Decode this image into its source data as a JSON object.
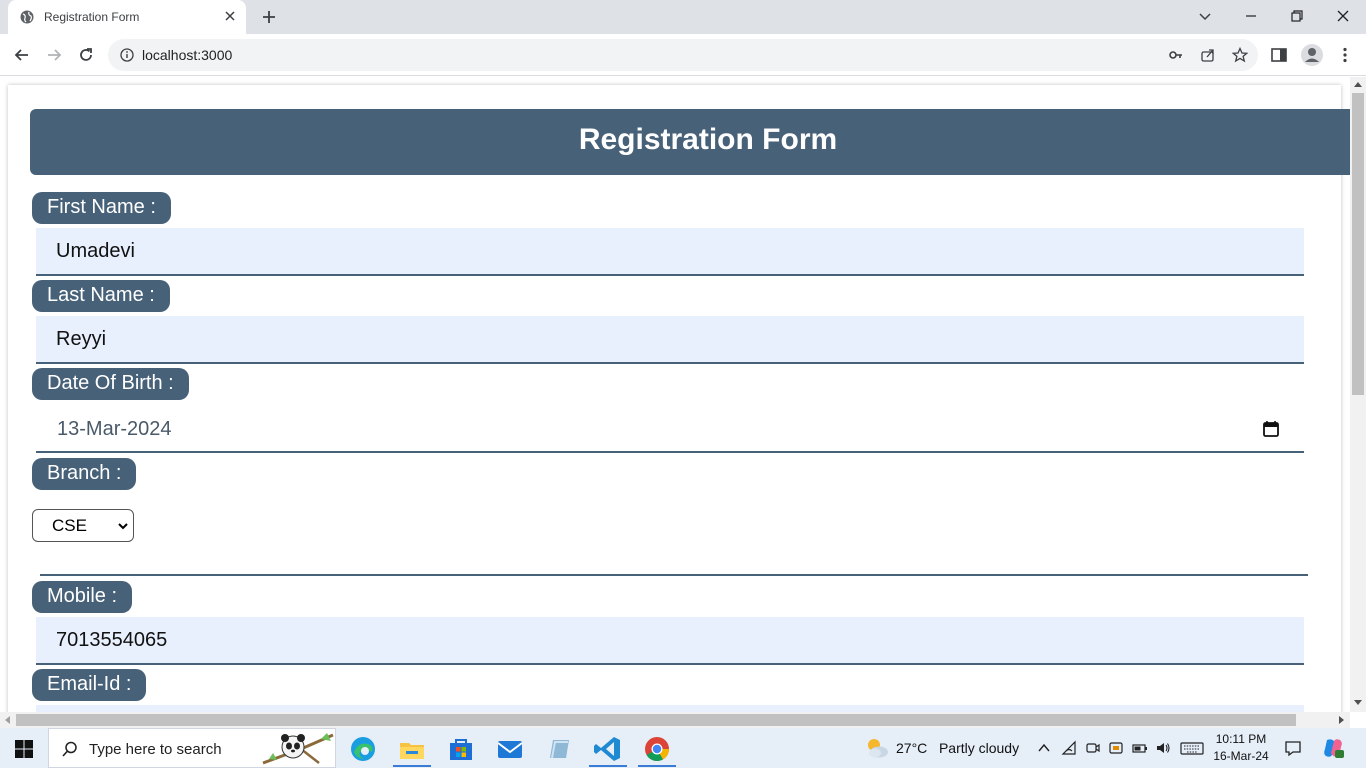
{
  "browser": {
    "tab_title": "Registration Form",
    "url": "localhost:3000"
  },
  "form": {
    "title": "Registration Form",
    "first_name_label": "First Name :",
    "first_name_value": "Umadevi",
    "last_name_label": "Last Name :",
    "last_name_value": "Reyyi",
    "dob_label": "Date Of Birth :",
    "dob_value": "13-Mar-2024",
    "branch_label": "Branch :",
    "branch_value": "CSE",
    "mobile_label": "Mobile :",
    "mobile_value": "7013554065",
    "email_label": "Email-Id :"
  },
  "taskbar": {
    "search_placeholder": "Type here to search",
    "temperature": "27°C",
    "weather": "Partly cloudy",
    "time": "10:11 PM",
    "date": "16-Mar-24"
  },
  "colors": {
    "accent": "#476178",
    "field_bg": "#e8f0fe"
  }
}
